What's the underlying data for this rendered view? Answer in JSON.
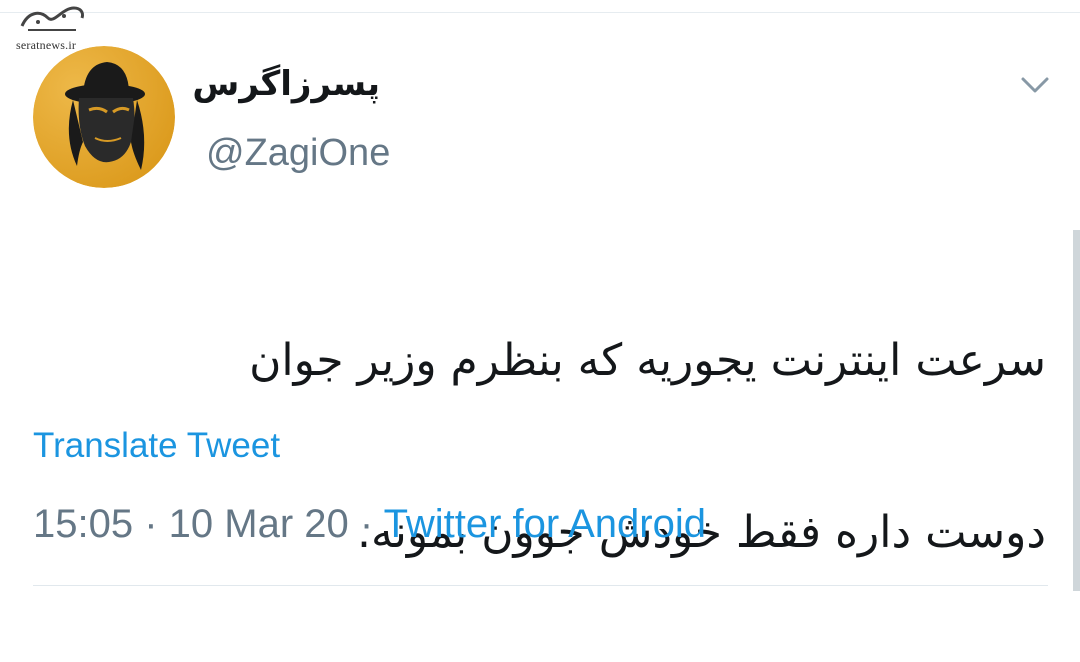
{
  "watermark": {
    "logo_text": "صراط",
    "site": "seratnews.ir"
  },
  "tweet": {
    "display_name": "پسرزاگرس",
    "handle": "@ZagiOne",
    "text_line1": "سرعت اینترنت یجوریه که بنظرم وزیر جوان",
    "text_line2": "دوست داره فقط خودش جوون بمونه.",
    "translate_label": "Translate Tweet",
    "time": "15:05",
    "separator": " · ",
    "date": "10 Mar 20",
    "source": "Twitter for Android"
  },
  "icons": {
    "avatar": "avatar-image",
    "menu": "chevron-down-icon"
  },
  "colors": {
    "link": "#1b95e0",
    "secondary_text": "#657786",
    "primary_text": "#14171a",
    "avatar_bg": "#e8a521"
  }
}
